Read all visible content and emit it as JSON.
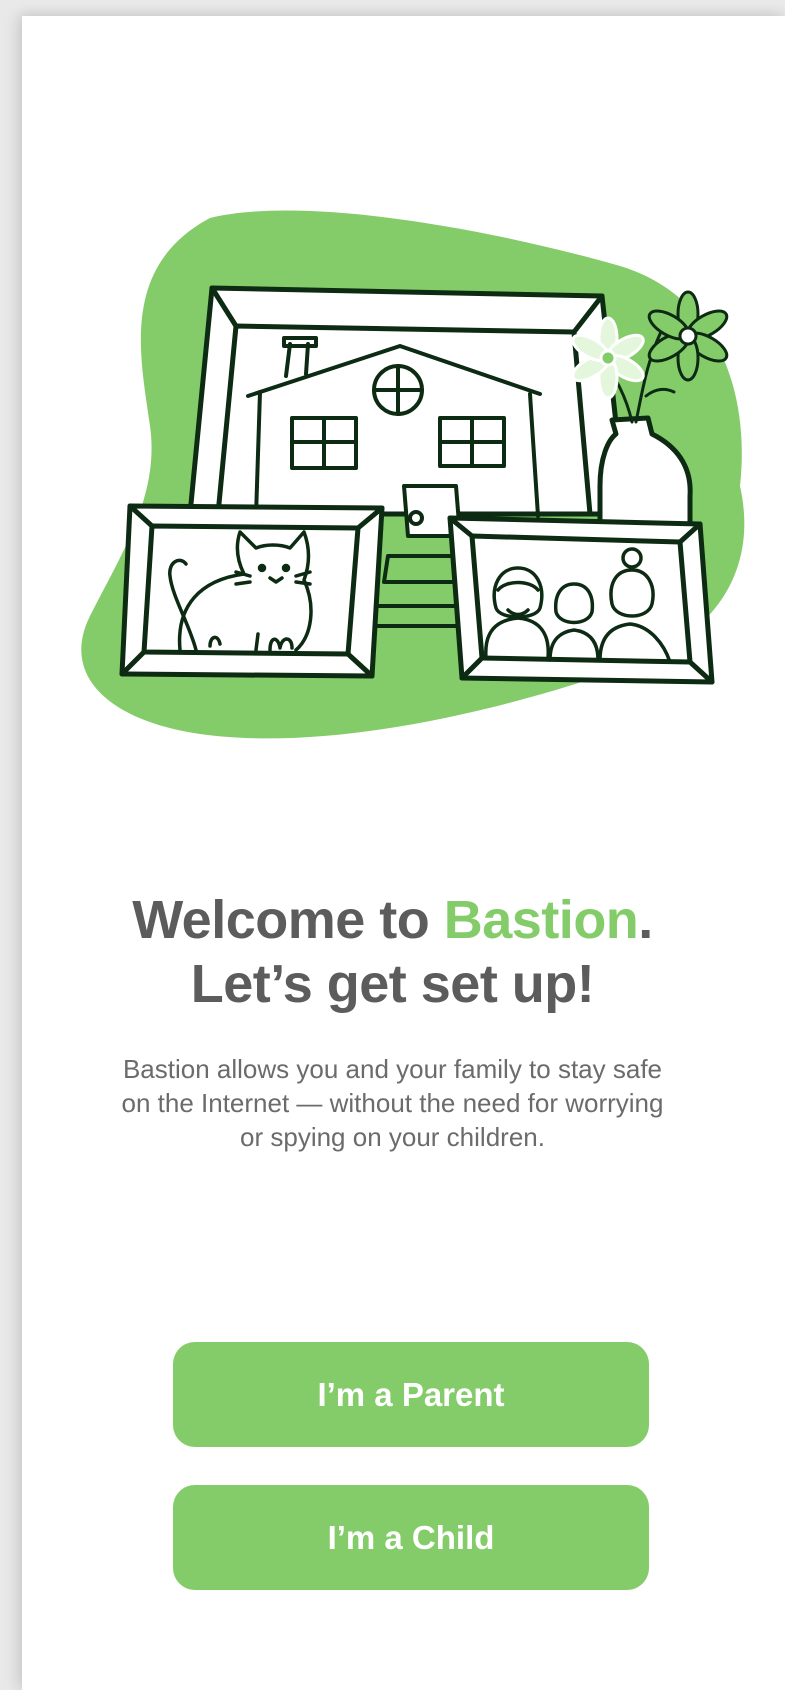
{
  "welcome": {
    "title_prefix": "Welcome to ",
    "brand": "Bastion",
    "title_suffix": ".",
    "title_line2": "Let’s get set up!",
    "description": "Bastion allows you and your family to stay safe on the Internet — without the need for worrying or spying on your children."
  },
  "actions": {
    "parent_label": "I’m a Parent",
    "child_label": "I’m a Child"
  },
  "colors": {
    "accent": "#84cc6a",
    "heading": "#5c5c5c",
    "body_text": "#6b6b6b",
    "outline": "#0d2a12"
  }
}
